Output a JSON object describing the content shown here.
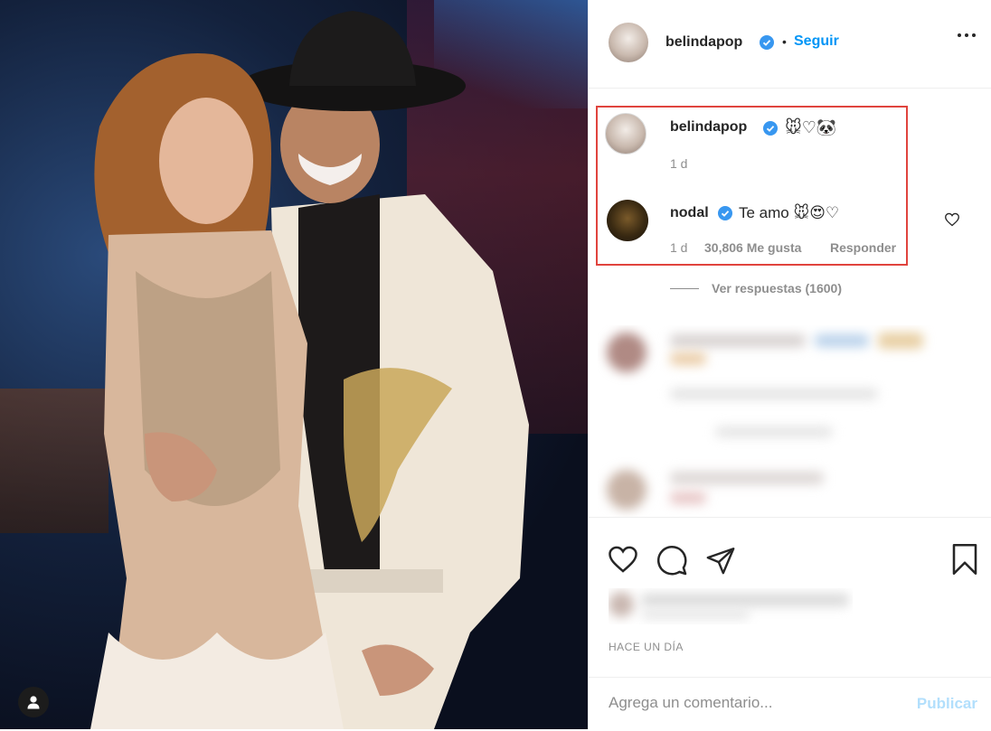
{
  "post": {
    "image_alt_icon": "user-tag-icon"
  },
  "header": {
    "username": "belindapop",
    "separator": "•",
    "follow_label": "Seguir",
    "more_icon": "more-options-icon"
  },
  "caption": {
    "username": "belindapop",
    "text": "🐭♡🐼",
    "time": "1 d"
  },
  "top_comment": {
    "username": "nodal",
    "text": "Te amo 🐭😍♡",
    "time": "1 d",
    "likes": "30,806 Me gusta",
    "reply_label": "Responder",
    "like_icon": "heart-icon"
  },
  "view_replies": {
    "label": "Ver respuestas (1600)"
  },
  "actions": {
    "like_icon": "heart-icon",
    "comment_icon": "comment-icon",
    "share_icon": "share-icon",
    "save_icon": "bookmark-icon",
    "timestamp": "HACE UN DÍA"
  },
  "comment_box": {
    "placeholder": "Agrega un comentario...",
    "publish_label": "Publicar"
  },
  "colors": {
    "link_blue": "#0095f6",
    "publish_disabled": "#b2dffc",
    "highlight_red": "#e0443e",
    "verified_blue": "#3897f0"
  }
}
